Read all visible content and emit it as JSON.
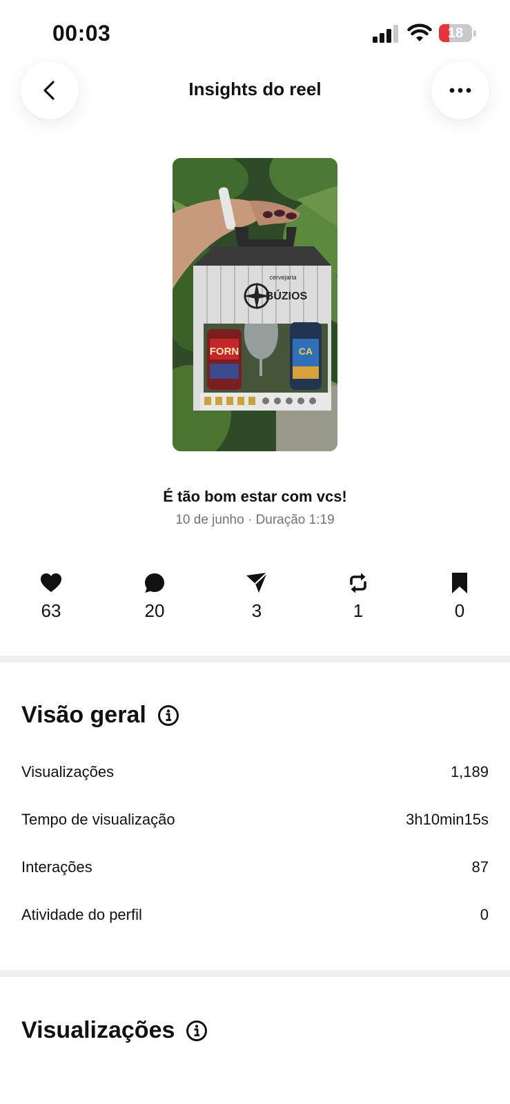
{
  "status_bar": {
    "time": "00:03",
    "battery_level": "18",
    "battery_fraction": 0.18,
    "battery_color": "#e5343b"
  },
  "header": {
    "title": "Insights do reel",
    "back_icon": "chevron-left-icon",
    "more_icon": "ellipsis-icon"
  },
  "reel": {
    "caption": "É tão bom estar com vcs!",
    "date": "10 de junho",
    "separator": "·",
    "duration": "Duração 1:19",
    "thumbnail_text": {
      "brand_small": "cervejaria",
      "brand_large": "BÚZIOS",
      "bottle_label_left": "FORN",
      "bottle_label_right": "CA"
    }
  },
  "stats": [
    {
      "icon": "heart-icon",
      "value": "63"
    },
    {
      "icon": "comment-icon",
      "value": "20"
    },
    {
      "icon": "share-icon",
      "value": "3"
    },
    {
      "icon": "repost-icon",
      "value": "1"
    },
    {
      "icon": "bookmark-icon",
      "value": "0"
    }
  ],
  "overview": {
    "title": "Visão geral",
    "info_icon": "info-icon",
    "rows": [
      {
        "label": "Visualizações",
        "value": "1,189"
      },
      {
        "label": "Tempo de visualização",
        "value": "3h10min15s"
      },
      {
        "label": "Interações",
        "value": "87"
      },
      {
        "label": "Atividade do perfil",
        "value": "0"
      }
    ]
  },
  "views_section": {
    "title": "Visualizações",
    "info_icon": "info-icon"
  }
}
